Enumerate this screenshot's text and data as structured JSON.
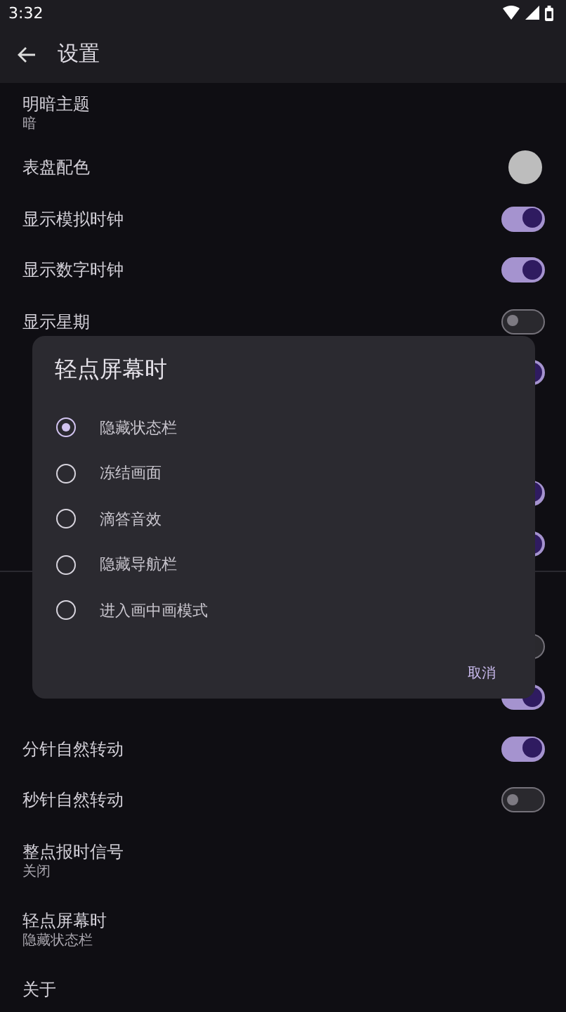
{
  "status_bar": {
    "time": "3:32"
  },
  "app_bar": {
    "title": "设置"
  },
  "settings": [
    {
      "kind": "text",
      "label": "明暗主题",
      "summary": "暗"
    },
    {
      "kind": "color",
      "label": "表盘配色",
      "color": "#bdbdbd"
    },
    {
      "kind": "toggle",
      "label": "显示模拟时钟",
      "on": true
    },
    {
      "kind": "toggle",
      "label": "显示数字时钟",
      "on": true
    },
    {
      "kind": "toggle",
      "label": "显示星期",
      "on": false
    },
    {
      "kind": "toggle",
      "on": true
    },
    {
      "kind": "text"
    },
    {
      "kind": "toggle",
      "on": true
    },
    {
      "kind": "toggle",
      "on": true
    },
    {
      "kind": "header"
    },
    {
      "kind": "toggle",
      "on": false
    },
    {
      "kind": "toggle",
      "on": true
    },
    {
      "kind": "toggle",
      "label": "分针自然转动",
      "on": true
    },
    {
      "kind": "toggle",
      "label": "秒针自然转动",
      "on": false
    },
    {
      "kind": "text",
      "label": "整点报时信号",
      "summary": "关闭"
    },
    {
      "kind": "text",
      "label": "轻点屏幕时",
      "summary": "隐藏状态栏"
    },
    {
      "kind": "text",
      "label": "关于"
    }
  ],
  "dialog": {
    "title": "轻点屏幕时",
    "options": [
      {
        "label": "隐藏状态栏",
        "selected": true
      },
      {
        "label": "冻结画面",
        "selected": false
      },
      {
        "label": "滴答音效",
        "selected": false
      },
      {
        "label": "隐藏导航栏",
        "selected": false
      },
      {
        "label": "进入画中画模式",
        "selected": false
      }
    ],
    "button": "取消"
  }
}
